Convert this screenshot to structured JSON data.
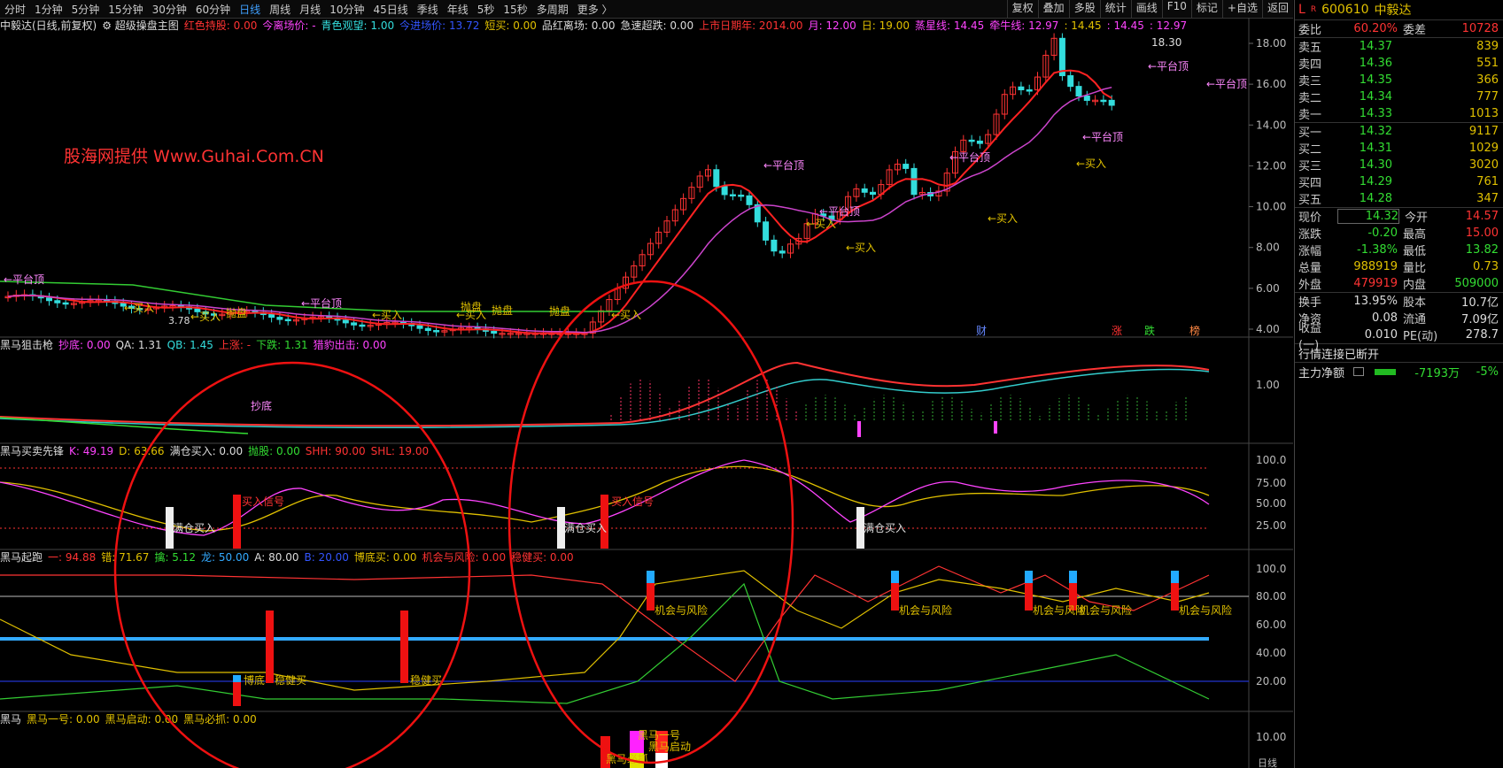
{
  "toolbar": {
    "periods": [
      "分时",
      "1分钟",
      "5分钟",
      "15分钟",
      "30分钟",
      "60分钟",
      "日线",
      "周线",
      "月线",
      "10分钟",
      "45日线",
      "季线",
      "年线",
      "5秒",
      "15秒",
      "多周期",
      "更多 〉"
    ],
    "active_index": 6,
    "right_buttons": [
      "复权",
      "叠加",
      "多股",
      "统计",
      "画线",
      "F10",
      "标记",
      "+自选",
      "返回"
    ]
  },
  "main_info": {
    "title": "中毅达(日线,前复权)",
    "indicator": "超级操盘主图",
    "items": [
      {
        "text": "红色持股: 0.00",
        "color": "#ff3333"
      },
      {
        "text": "今离场价: -",
        "color": "#ff44ff"
      },
      {
        "text": "青色观望: 1.00",
        "color": "#33dddd"
      },
      {
        "text": "今进场价: 13.72",
        "color": "#3355ff"
      },
      {
        "text": "短买: 0.00",
        "color": "#e0c000"
      },
      {
        "text": "品红离场: 0.00",
        "color": "#ddd"
      },
      {
        "text": "急速超跌: 0.00",
        "color": "#ddd"
      },
      {
        "text": "上市日期年: 2014.00",
        "color": "#ff3333"
      },
      {
        "text": "月: 12.00",
        "color": "#ff44ff"
      },
      {
        "text": "日: 19.00",
        "color": "#e0c000"
      },
      {
        "text": "蒸星线: 14.45",
        "color": "#ff44ff"
      },
      {
        "text": "牵牛线: 12.97",
        "color": "#ff44ff"
      },
      {
        "text": ": 14.45",
        "color": "#e0c000"
      },
      {
        "text": ": 14.45",
        "color": "#ff44ff"
      },
      {
        "text": ": 12.97",
        "color": "#ff44ff"
      }
    ]
  },
  "watermark": "股海网提供 Www.Guhai.Com.CN",
  "sub1_info": {
    "title": "黑马狙击枪",
    "items": [
      {
        "text": "抄底: 0.00",
        "color": "#ff44ff"
      },
      {
        "text": "QA: 1.31",
        "color": "#ddd"
      },
      {
        "text": "QB: 1.45",
        "color": "#33dddd"
      },
      {
        "text": "上涨: -",
        "color": "#ff3333"
      },
      {
        "text": "下跌: 1.31",
        "color": "#33dd33"
      },
      {
        "text": "猎豹出击: 0.00",
        "color": "#ff44ff"
      }
    ]
  },
  "sub2_info": {
    "title": "黑马买卖先锋",
    "items": [
      {
        "text": "K: 49.19",
        "color": "#ff44ff"
      },
      {
        "text": "D: 63.66",
        "color": "#e0c000"
      },
      {
        "text": "满仓买入: 0.00",
        "color": "#ddd"
      },
      {
        "text": "抛股: 0.00",
        "color": "#33dd33"
      },
      {
        "text": "SHH: 90.00",
        "color": "#ff3333"
      },
      {
        "text": "SHL: 19.00",
        "color": "#ff3333"
      }
    ]
  },
  "sub3_info": {
    "title": "黑马起跑",
    "items": [
      {
        "text": "一: 94.88",
        "color": "#ff3333"
      },
      {
        "text": "错: 71.67",
        "color": "#e0c000"
      },
      {
        "text": "擒: 5.12",
        "color": "#33dd33"
      },
      {
        "text": "龙: 50.00",
        "color": "#33aaff"
      },
      {
        "text": "A: 80.00",
        "color": "#ddd"
      },
      {
        "text": "B: 20.00",
        "color": "#3355ff"
      },
      {
        "text": "博底买: 0.00",
        "color": "#e0c000"
      },
      {
        "text": "机会与风险: 0.00",
        "color": "#ff3333"
      },
      {
        "text": "稳健买: 0.00",
        "color": "#ff3333"
      }
    ]
  },
  "sub4_info": {
    "title": "黑马",
    "items": [
      {
        "text": "黑马一号: 0.00",
        "color": "#e0c000"
      },
      {
        "text": "黑马启动: 0.00",
        "color": "#e0c000"
      },
      {
        "text": "黑马必抓: 0.00",
        "color": "#e0c000"
      }
    ]
  },
  "axes": {
    "main": [
      "18.00",
      "16.00",
      "14.00",
      "12.00",
      "10.00",
      "8.00",
      "6.00",
      "4.00"
    ],
    "sub1": [
      "1.00"
    ],
    "sub2": [
      "100.0",
      "75.00",
      "50.00",
      "25.00"
    ],
    "sub3": [
      "100.0",
      "80.00",
      "60.00",
      "40.00",
      "20.00"
    ],
    "sub4": [
      "10.00"
    ],
    "bottom_right": "日线"
  },
  "annotations": {
    "high_price": "18.30",
    "low_price": "3.78",
    "platform_top": "平台顶",
    "buy": "买入",
    "sell": "抛盘",
    "bottom": "抄底",
    "full_buy": "满仓买入",
    "buy_signal": "买入信号",
    "chance_risk": "机会与风险",
    "bottom_buy": "博底",
    "steady_buy": "稳健买",
    "dark_horse_one": "黑马一号",
    "dark_horse_start": "黑马启动",
    "dark_horse_catch": "黑马必抓",
    "markers": [
      "财",
      "涨",
      "跌",
      "榜"
    ]
  },
  "quote": {
    "code": "600610",
    "name": "中毅达",
    "wb": "委比",
    "wb_val": "60.20%",
    "wc": "委差",
    "wc_val": "10728",
    "sell": [
      {
        "label": "卖五",
        "price": "14.37",
        "vol": "839"
      },
      {
        "label": "卖四",
        "price": "14.36",
        "vol": "551"
      },
      {
        "label": "卖三",
        "price": "14.35",
        "vol": "366"
      },
      {
        "label": "卖二",
        "price": "14.34",
        "vol": "777"
      },
      {
        "label": "卖一",
        "price": "14.33",
        "vol": "1013"
      }
    ],
    "buy": [
      {
        "label": "买一",
        "price": "14.32",
        "vol": "9117"
      },
      {
        "label": "买二",
        "price": "14.31",
        "vol": "1029"
      },
      {
        "label": "买三",
        "price": "14.30",
        "vol": "3020"
      },
      {
        "label": "买四",
        "price": "14.29",
        "vol": "761"
      },
      {
        "label": "买五",
        "price": "14.28",
        "vol": "347"
      }
    ],
    "stats": [
      {
        "l1": "现价",
        "v1": "14.32",
        "c1": "green",
        "l2": "今开",
        "v2": "14.57",
        "c2": "red"
      },
      {
        "l1": "涨跌",
        "v1": "-0.20",
        "c1": "green",
        "l2": "最高",
        "v2": "15.00",
        "c2": "red"
      },
      {
        "l1": "涨幅",
        "v1": "-1.38%",
        "c1": "green",
        "l2": "最低",
        "v2": "13.82",
        "c2": "green"
      },
      {
        "l1": "总量",
        "v1": "988919",
        "c1": "yellow",
        "l2": "量比",
        "v2": "0.73",
        "c2": "yellow"
      },
      {
        "l1": "外盘",
        "v1": "479919",
        "c1": "red",
        "l2": "内盘",
        "v2": "509000",
        "c2": "green"
      },
      {
        "l1": "换手",
        "v1": "13.95%",
        "c1": "white",
        "l2": "股本",
        "v2": "10.7亿",
        "c2": "white"
      },
      {
        "l1": "净资",
        "v1": "0.08",
        "c1": "white",
        "l2": "流通",
        "v2": "7.09亿",
        "c2": "white"
      },
      {
        "l1": "收益(一)",
        "v1": "0.010",
        "c1": "white",
        "l2": "PE(动)",
        "v2": "278.7",
        "c2": "white"
      }
    ],
    "status": "行情连接已断开",
    "net_flow_label": "主力净额",
    "net_flow_val": "-7193万",
    "net_flow_pct": "-5%"
  },
  "colors": {
    "up": "#ff3333",
    "down": "#33dddd",
    "ma1": "#ff2222",
    "ma2": "#cc44cc",
    "green_line": "#33cc33"
  }
}
